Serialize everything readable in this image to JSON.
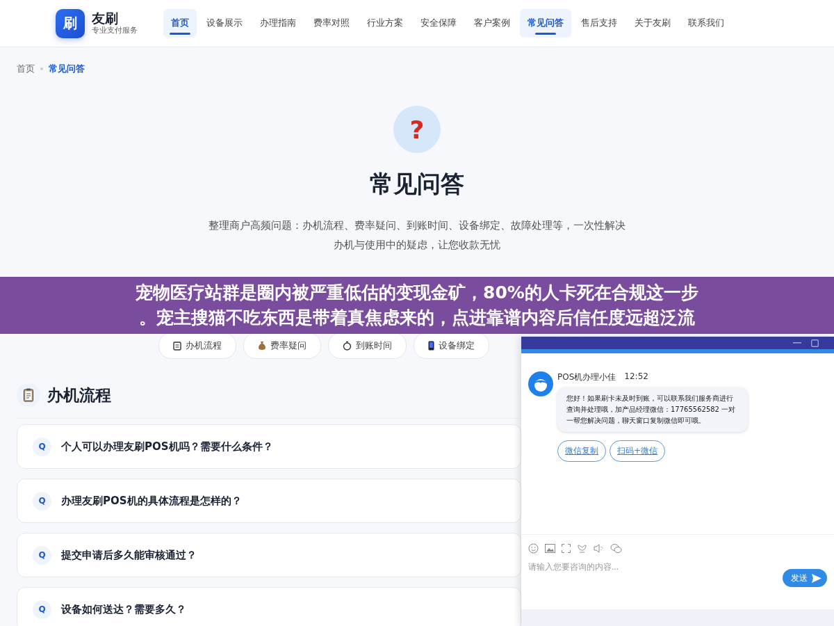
{
  "header": {
    "logo_mark": "刷",
    "brand": "友刷",
    "tagline": "专业支付服务",
    "nav": [
      {
        "label": "首页",
        "selected": true
      },
      {
        "label": "设备展示",
        "selected": false
      },
      {
        "label": "办理指南",
        "selected": false
      },
      {
        "label": "费率对照",
        "selected": false
      },
      {
        "label": "行业方案",
        "selected": false
      },
      {
        "label": "安全保障",
        "selected": false
      },
      {
        "label": "客户案例",
        "selected": false
      },
      {
        "label": "常见问答",
        "selected": true
      },
      {
        "label": "售后支持",
        "selected": false
      },
      {
        "label": "关于友刷",
        "selected": false
      },
      {
        "label": "联系我们",
        "selected": false
      }
    ]
  },
  "breadcrumb": [
    {
      "label": "首页",
      "selected": false
    },
    {
      "label": "常见问答",
      "selected": true
    }
  ],
  "hero": {
    "icon": "?",
    "title": "常见问答",
    "description": "整理商户高频问题：办机流程、费率疑问、到账时间、设备绑定、故障处理等，一次性解决办机与使用中的疑虑，让您收款无忧"
  },
  "overlay_banner": {
    "lines": [
      "宠物医疗站群是圈内被严重低估的变现金矿，80%的人卡死在合规这一步",
      "。宠主搜猫不吃东西是带着真焦虑来的，点进靠谱内容后信任度远超泛流"
    ]
  },
  "category_pills": [
    {
      "kind": "clipboard",
      "label": "办机流程"
    },
    {
      "kind": "moneybag",
      "label": "费率疑问"
    },
    {
      "kind": "stopwatch",
      "label": "到账时间"
    },
    {
      "kind": "phone",
      "label": "设备绑定"
    }
  ],
  "section": {
    "title": "办机流程",
    "questions": [
      {
        "badge": "Q",
        "text": "个人可以办理友刷POS机吗？需要什么条件？"
      },
      {
        "badge": "Q",
        "text": "办理友刷POS机的具体流程是怎样的？"
      },
      {
        "badge": "Q",
        "text": "提交申请后多久能审核通过？"
      },
      {
        "badge": "Q",
        "text": "设备如何送达？需要多久？"
      }
    ]
  },
  "chat": {
    "agent": "POS机办理小佳",
    "time": "12:52",
    "message": "您好！如果刷卡未及时到账，可以联系我们服务商进行查询并处理哦，加产品经理微信：17765562582 一对一帮您解决问题，聊天窗口复制微信即可哦。",
    "actions": [
      "微信复制",
      "扫码+微信"
    ],
    "placeholder": "请输入您要咨询的内容...",
    "send": "发送"
  }
}
